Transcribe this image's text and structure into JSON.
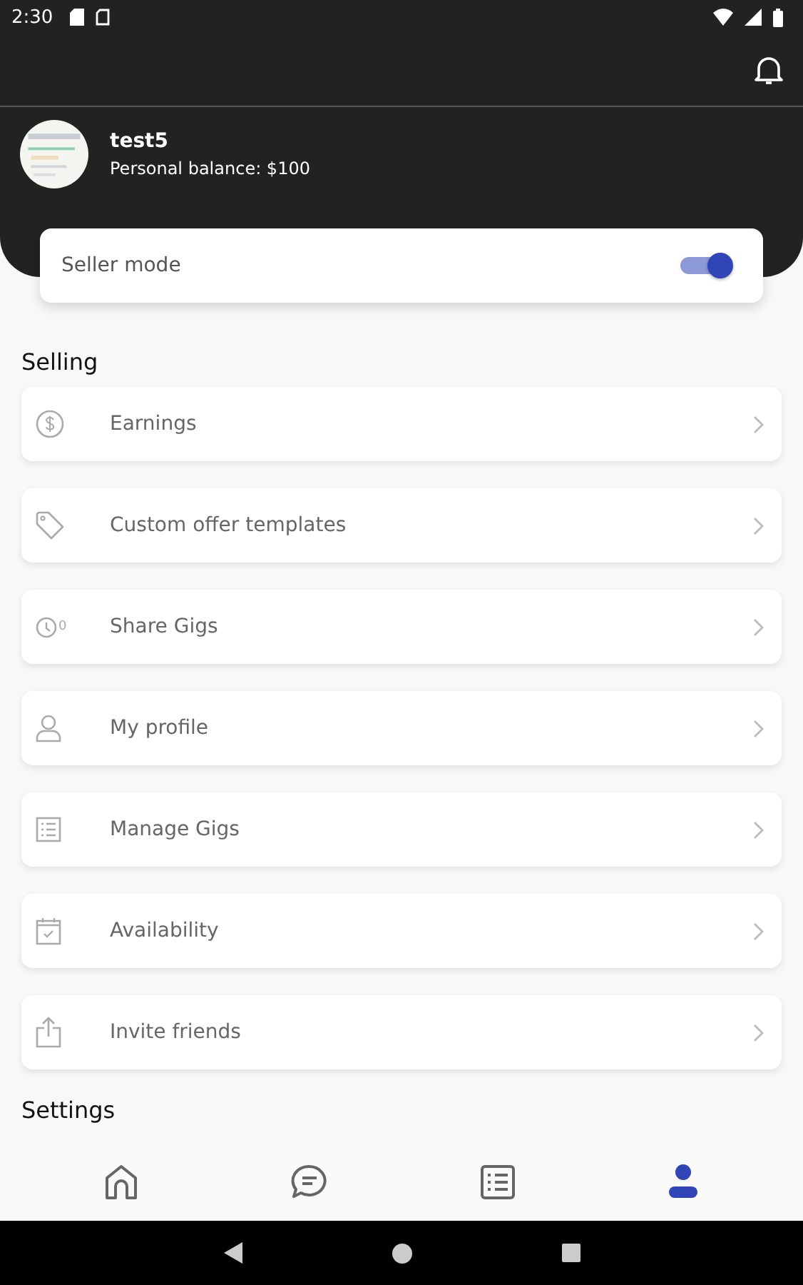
{
  "status_bar": {
    "time": "2:30"
  },
  "profile": {
    "name": "test5",
    "balance": "Personal balance: $100"
  },
  "seller_mode": {
    "label": "Seller mode",
    "on": true
  },
  "sections": [
    {
      "title": "Selling",
      "items": [
        {
          "kind": "earnings",
          "label": "Earnings"
        },
        {
          "kind": "tag",
          "label": "Custom offer templates"
        },
        {
          "kind": "clock",
          "label": "Share Gigs",
          "badge": "0"
        },
        {
          "kind": "person",
          "label": "My profile"
        },
        {
          "kind": "list",
          "label": "Manage Gigs"
        },
        {
          "kind": "calendar",
          "label": "Availability"
        },
        {
          "kind": "share",
          "label": "Invite friends"
        }
      ]
    },
    {
      "title": "Settings"
    }
  ],
  "bottom_nav": [
    {
      "kind": "home",
      "selected": false
    },
    {
      "kind": "chat",
      "selected": false
    },
    {
      "kind": "orders",
      "selected": false
    },
    {
      "kind": "profile",
      "selected": true
    }
  ]
}
